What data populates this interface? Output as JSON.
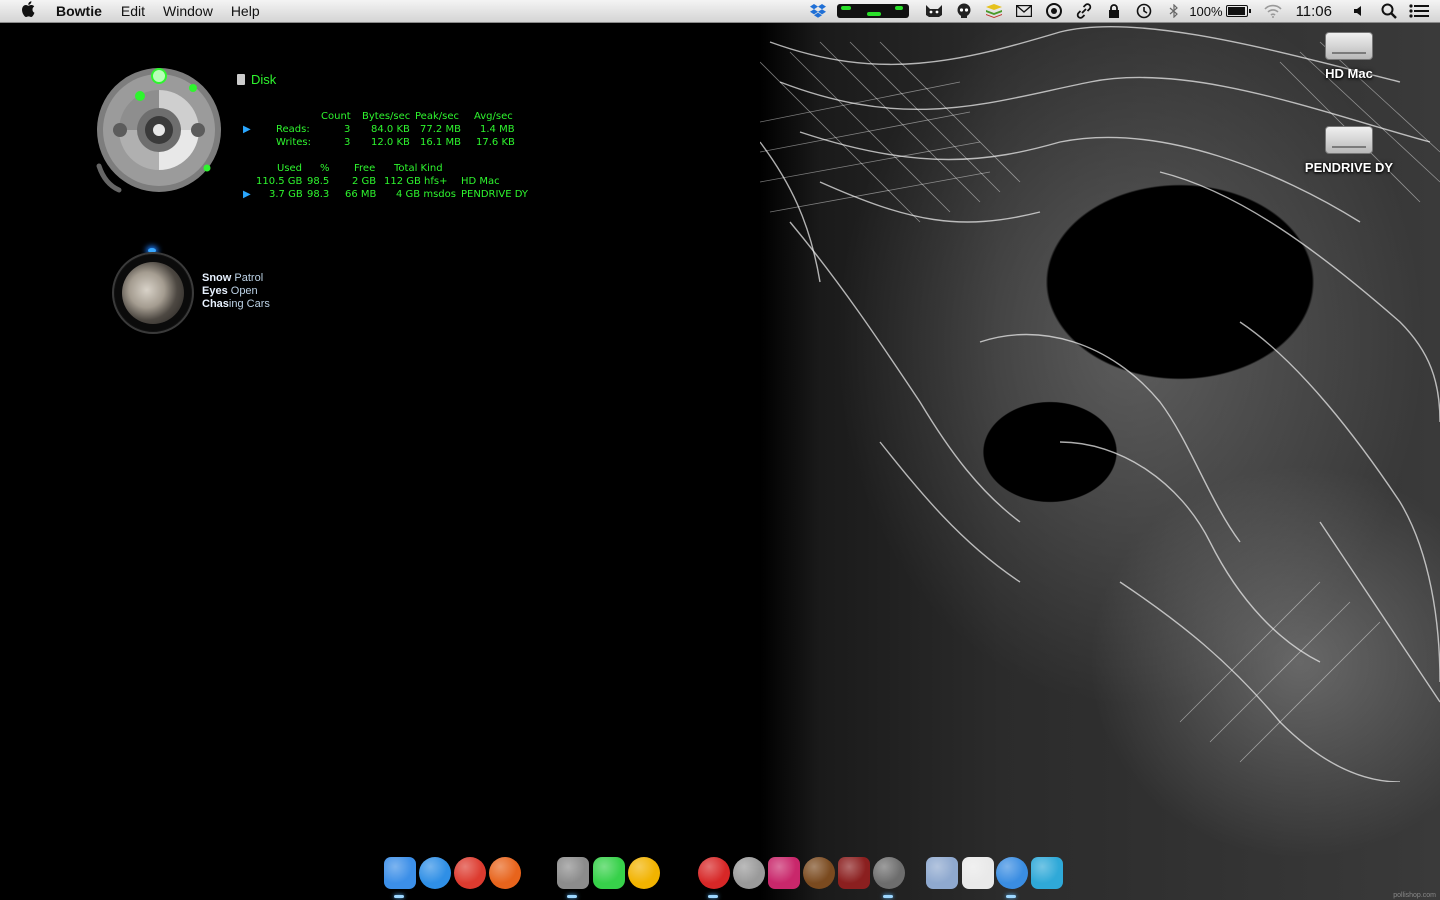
{
  "menubar": {
    "app_name": "Bowtie",
    "menus": [
      "Edit",
      "Window",
      "Help"
    ],
    "battery": "100%",
    "clock": "11:06"
  },
  "disk": {
    "title": "Disk",
    "io_headers": [
      "Count",
      "Bytes/sec",
      "Peak/sec",
      "Avg/sec"
    ],
    "io_rows": [
      {
        "label": "Reads:",
        "count": "3",
        "bytes": "84.0 KB",
        "peak": "77.2 MB",
        "avg": "1.4 MB"
      },
      {
        "label": "Writes:",
        "count": "3",
        "bytes": "12.0 KB",
        "peak": "16.1 MB",
        "avg": "17.6 KB"
      }
    ],
    "vol_headers": [
      "Used",
      "%",
      "Free",
      "Total Kind"
    ],
    "vol_rows": [
      {
        "used": "110.5 GB",
        "pct": "98.5",
        "free": "2 GB",
        "total_kind": "112 GB hfs+",
        "name": "HD Mac"
      },
      {
        "used": "3.7 GB",
        "pct": "98.3",
        "free": "66 MB",
        "total_kind": "4 GB msdos",
        "name": "PENDRIVE DY"
      }
    ]
  },
  "now_playing": {
    "artist": [
      "Snow",
      " Patrol"
    ],
    "album": [
      "Eyes",
      " Open"
    ],
    "track": [
      "Chas",
      "ing Cars"
    ]
  },
  "desktop_icons": [
    {
      "label": "HD Mac",
      "icon": "hard-drive-icon"
    },
    {
      "label": "PENDRIVE DY",
      "icon": "usb-drive-icon"
    }
  ],
  "dock_apps": [
    {
      "icon": "finder-icon",
      "color": "#3c8fe8"
    },
    {
      "icon": "safari-icon",
      "color": "#2f8fe6"
    },
    {
      "icon": "chrome-icon",
      "color": "#dd3b2f"
    },
    {
      "icon": "firefox-icon",
      "color": "#e8641c"
    },
    {
      "icon": "photo-app-icon",
      "color": "#8c8c8c"
    },
    {
      "icon": "messages-icon",
      "color": "#37d14a"
    },
    {
      "icon": "office-icon",
      "color": "#f2b300"
    },
    {
      "icon": "rocket-app-icon",
      "color": "#d72727"
    },
    {
      "icon": "system-preferences-icon",
      "color": "#9a9a9a"
    },
    {
      "icon": "game-star-icon",
      "color": "#c9276b"
    },
    {
      "icon": "game-bowl-icon",
      "color": "#7a4a1f"
    },
    {
      "icon": "game-poster-icon",
      "color": "#8b1f1f"
    },
    {
      "icon": "dvd-player-icon",
      "color": "#6d6d6d"
    },
    {
      "icon": "documents-folder-icon",
      "color": "#8fa9cf"
    },
    {
      "icon": "document-icon",
      "color": "#e9e9e9"
    },
    {
      "icon": "itunes-icon",
      "color": "#3a8de2"
    },
    {
      "icon": "preview-icon",
      "color": "#2fa9d8"
    }
  ],
  "watermark": "pollishop.com"
}
